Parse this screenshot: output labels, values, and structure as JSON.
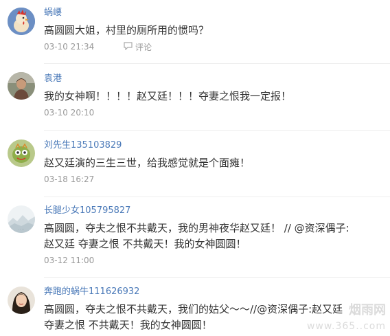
{
  "colors": {
    "username": "#4a79b8",
    "text": "#333333",
    "meta": "#999999",
    "divider": "#eeeeee"
  },
  "comments": [
    {
      "username": "蜗崾",
      "text": "高圆圆大姐，村里的厕所用的惯吗？",
      "time": "03-10 21:34",
      "reply_label": "评论",
      "avatar_icon": "rooster-avatar"
    },
    {
      "username": "袁港",
      "text": "我的女神啊！！！！赵又廷！！！夺妻之恨我一定报！",
      "time": "03-10 20:10",
      "avatar_icon": "person-photo-avatar"
    },
    {
      "username": "刘先生135103829",
      "text": "赵又廷演的三生三世，给我感觉就是个面瘫！",
      "time": "03-18 16:27",
      "avatar_icon": "cartoon-avatar"
    },
    {
      "username": "长腿少女105795827",
      "text_line1": "高圆圆，夺夫之恨不共戴天，我的男神夜华赵又廷！ // @资深偶子:",
      "text_line2": "赵又廷 夺妻之恨 不共戴天！我的女神圆圆！",
      "time": "03-12 11:00",
      "avatar_icon": "landscape-avatar"
    },
    {
      "username": "奔跑的蜗牛111626932",
      "text_line1": "高圆圆，夺夫之恨不共戴天，我们的姑父～～//@资深偶子:赵又廷",
      "text_line2": "夺妻之恨 不共戴天！我的女神圆圆！",
      "avatar_icon": "woman-photo-avatar"
    }
  ],
  "watermark": {
    "site": "烟雨网",
    "url": "www.365..com"
  }
}
